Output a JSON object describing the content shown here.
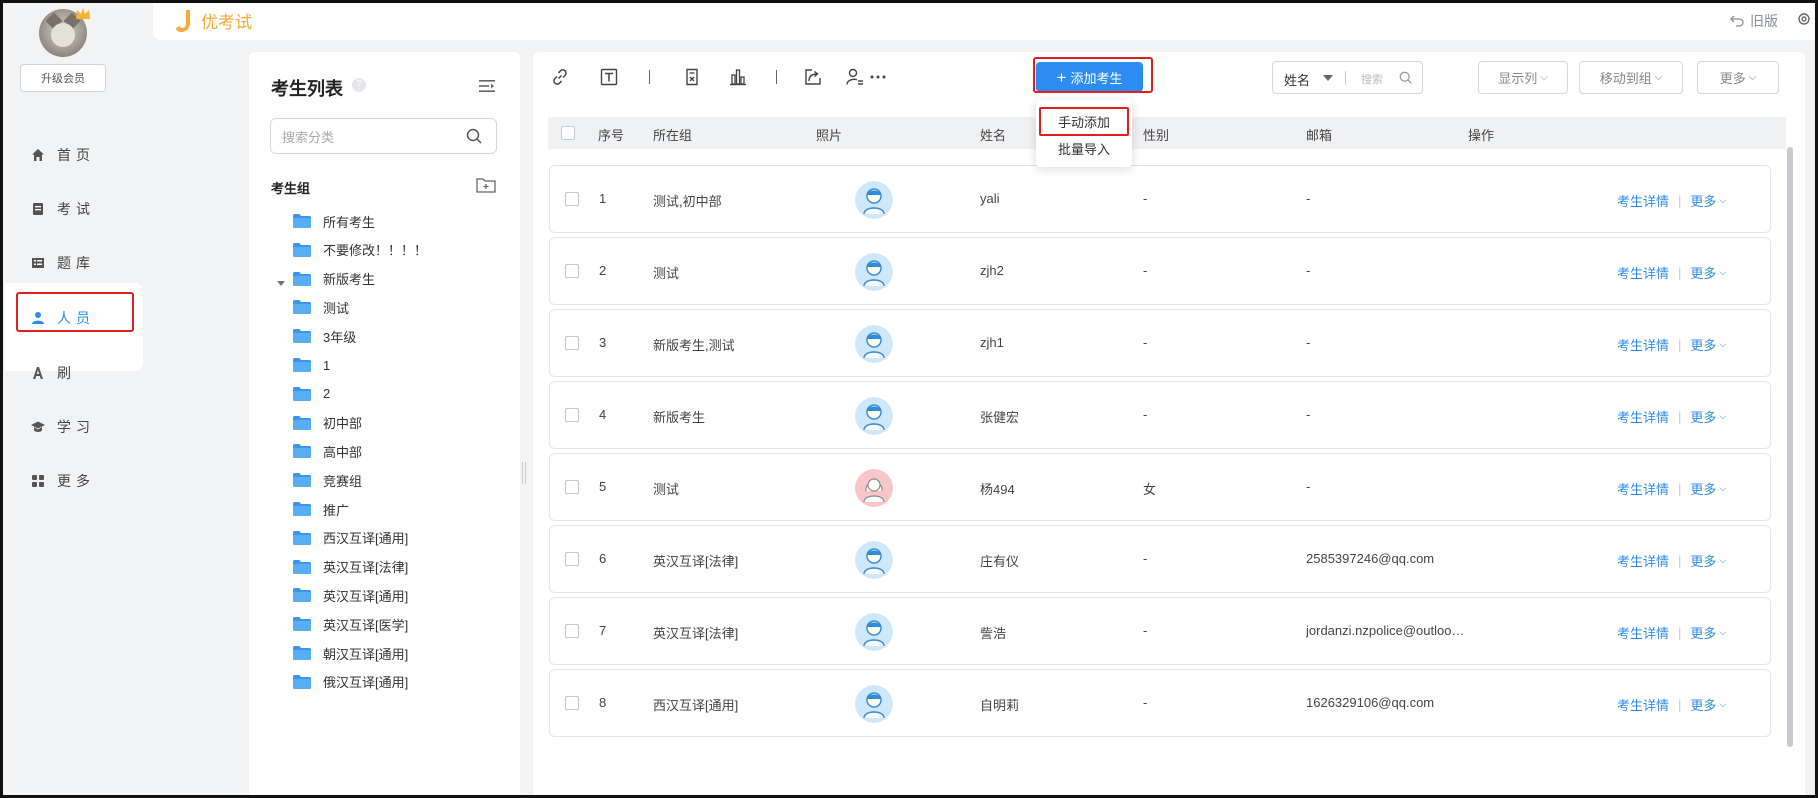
{
  "nav": {
    "upgrade_label": "升级会员",
    "items": [
      {
        "label": "首页",
        "icon": "home-icon"
      },
      {
        "label": "考试",
        "icon": "exam-icon"
      },
      {
        "label": "题库",
        "icon": "question-bank-icon"
      },
      {
        "label": "人员",
        "icon": "person-icon",
        "active": true
      },
      {
        "label": "刷题",
        "display": "A 刷",
        "icon": "letter-a-icon"
      },
      {
        "label": "学习",
        "icon": "graduation-cap-icon"
      },
      {
        "label": "更多",
        "icon": "grid-icon"
      }
    ]
  },
  "header": {
    "logo_text": "优考试",
    "old_version_label": "旧版"
  },
  "group_panel": {
    "title": "考生列表",
    "search_placeholder": "搜索分类",
    "group_heading": "考生组",
    "groups": [
      {
        "label": "所有考生",
        "level": 0
      },
      {
        "label": "不要修改！！！！",
        "level": 0
      },
      {
        "label": "新版考生",
        "level": 0,
        "expanded": true
      },
      {
        "label": "测试",
        "level": 1
      },
      {
        "label": "3年级",
        "level": 1
      },
      {
        "label": "1",
        "level": 1
      },
      {
        "label": "2",
        "level": 1
      },
      {
        "label": "初中部",
        "level": 1
      },
      {
        "label": "高中部",
        "level": 1
      },
      {
        "label": "竞赛组",
        "level": 1
      },
      {
        "label": "推广",
        "level": 1
      },
      {
        "label": "西汉互译[通用]",
        "level": 1
      },
      {
        "label": "英汉互译[法律]",
        "level": 1
      },
      {
        "label": "英汉互译[通用]",
        "level": 1
      },
      {
        "label": "英汉互译[医学]",
        "level": 1
      },
      {
        "label": "朝汉互译[通用]",
        "level": 1
      },
      {
        "label": "俄汉互译[通用]",
        "level": 1
      }
    ]
  },
  "toolbar": {
    "add_button_label": "添加考生",
    "dropdown_options": [
      "手动添加",
      "批量导入"
    ],
    "search_field_label": "姓名",
    "search_placeholder": "搜索",
    "columns_button": "显示列",
    "move_button": "移动到组",
    "more_button": "更多"
  },
  "table": {
    "columns": [
      "序号",
      "所在组",
      "照片",
      "姓名",
      "性别",
      "邮箱",
      "操作"
    ],
    "detail_label": "考生详情",
    "more_label": "更多",
    "rows": [
      {
        "index": "1",
        "group": "测试,初中部",
        "photo": "male",
        "name": "yali",
        "gender": "-",
        "email": "-"
      },
      {
        "index": "2",
        "group": "测试",
        "photo": "male",
        "name": "zjh2",
        "gender": "-",
        "email": "-"
      },
      {
        "index": "3",
        "group": "新版考生,测试",
        "photo": "male",
        "name": "zjh1",
        "gender": "-",
        "email": "-"
      },
      {
        "index": "4",
        "group": "新版考生",
        "photo": "male",
        "name": "张健宏",
        "gender": "-",
        "email": "-"
      },
      {
        "index": "5",
        "group": "测试",
        "photo": "female",
        "name": "杨494",
        "gender": "女",
        "email": "-"
      },
      {
        "index": "6",
        "group": "英汉互译[法律]",
        "photo": "male",
        "name": "庄有仪",
        "gender": "-",
        "email": "2585397246@qq.com"
      },
      {
        "index": "7",
        "group": "英汉互译[法律]",
        "photo": "male",
        "name": "訾浩",
        "gender": "-",
        "email": "jordanzi.nzpolice@outlook.com"
      },
      {
        "index": "8",
        "group": "西汉互译[通用]",
        "photo": "male",
        "name": "自明莉",
        "gender": "-",
        "email": "1626329106@qq.com"
      }
    ]
  },
  "colors": {
    "accent": "#2d8cf0",
    "highlight": "#e02020",
    "logo": "#f7a93a"
  }
}
